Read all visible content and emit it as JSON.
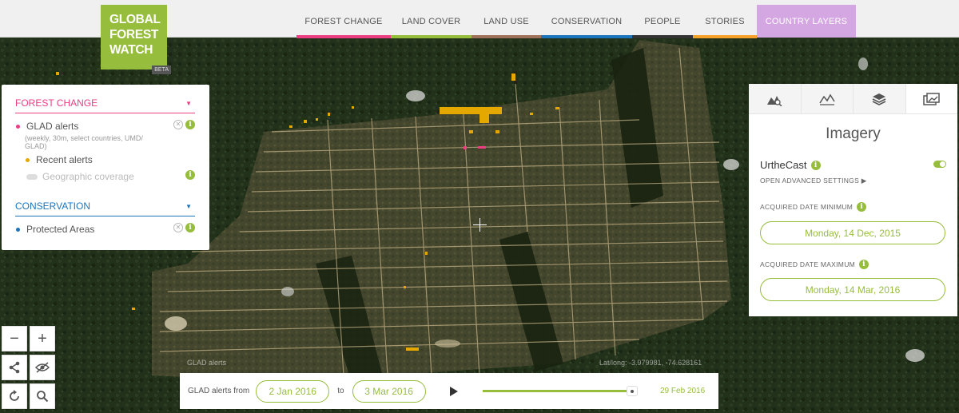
{
  "logo": {
    "line1": "GLOBAL",
    "line2": "FOREST",
    "line3": "WATCH",
    "badge": "BETA"
  },
  "nav": [
    {
      "label": "FOREST CHANGE",
      "color": "#ed3e83"
    },
    {
      "label": "LAND COVER",
      "color": "#97bd3d"
    },
    {
      "label": "LAND USE",
      "color": "#a0715b"
    },
    {
      "label": "CONSERVATION",
      "color": "#1b75bc"
    },
    {
      "label": "PEOPLE",
      "color": "#333333"
    },
    {
      "label": "STORIES",
      "color": "#f7a12b"
    },
    {
      "label": "COUNTRY LAYERS",
      "color": "#d5a7e2"
    }
  ],
  "left_panel": {
    "forest_change": {
      "title": "FOREST CHANGE",
      "color": "#ed3e83",
      "glad_label": "GLAD alerts",
      "glad_desc": "(weekly, 30m, select countries, UMD/ GLAD)",
      "recent_label": "Recent alerts",
      "coverage_label": "Geographic coverage"
    },
    "conservation": {
      "title": "CONSERVATION",
      "color": "#1b75bc",
      "protected_label": "Protected Areas"
    }
  },
  "right_panel": {
    "tabs": [
      "analysis-icon",
      "chart-icon",
      "layers-icon",
      "imagery-icon"
    ],
    "title": "Imagery",
    "source": "UrtheCast",
    "advanced": "OPEN ADVANCED SETTINGS",
    "min_label": "ACQUIRED DATE MINIMUM",
    "min_value": "Monday, 14 Dec, 2015",
    "max_label": "ACQUIRED DATE MAXIMUM",
    "max_value": "Monday, 14 Mar, 2016"
  },
  "map": {
    "glad_label": "GLAD alerts",
    "latlong": "Lat/long: -3.979981, -74.628161"
  },
  "timeline": {
    "label": "GLAD alerts from",
    "from": "2 Jan 2016",
    "to_word": "to",
    "to": "3 Mar 2016",
    "current": "29 Feb  2016",
    "progress": 0.95
  },
  "colors": {
    "accent": "#97bd3d",
    "alert": "#e5a800"
  }
}
